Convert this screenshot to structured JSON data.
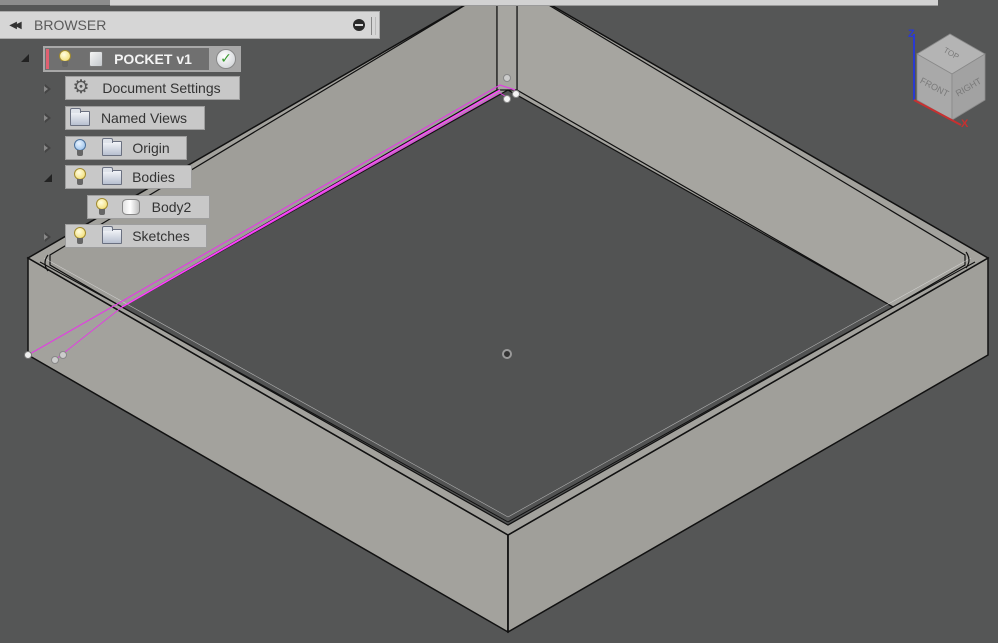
{
  "browser": {
    "collapse_icon": "double-left-arrow",
    "title": "BROWSER",
    "pin_icon": "minus-circle"
  },
  "tree": {
    "root": {
      "label": "POCKET v1",
      "visibility_icon": "lightbulb",
      "type_icon": "component-cube",
      "status_icon": "checkmark",
      "expanded": true
    },
    "items": [
      {
        "label": "Document Settings",
        "icon": "gear",
        "expanded": false
      },
      {
        "label": "Named Views",
        "icon": "folder",
        "expanded": false
      },
      {
        "label": "Origin",
        "icon": "folder",
        "visibility": "lightbulb-off",
        "expanded": false
      },
      {
        "label": "Bodies",
        "icon": "folder",
        "visibility": "lightbulb-on",
        "expanded": true,
        "children": [
          {
            "label": "Body2",
            "icon": "body",
            "visibility": "lightbulb-on"
          }
        ]
      },
      {
        "label": "Sketches",
        "icon": "folder",
        "visibility": "lightbulb-on",
        "expanded": false
      }
    ]
  },
  "viewcube": {
    "faces": {
      "top": "TOP",
      "front": "FRONT",
      "right": "RIGHT"
    },
    "axes": {
      "z": "Z",
      "x": "X"
    },
    "colors": {
      "z_axis": "#2a3ad0",
      "x_axis": "#c83030"
    }
  },
  "model": {
    "name": "Body2",
    "colors": {
      "background": "#555656",
      "body_face": "#a3a29d",
      "pocket_floor": "#525353",
      "edge": "#111111",
      "sketch_line": "#e040e0"
    }
  }
}
